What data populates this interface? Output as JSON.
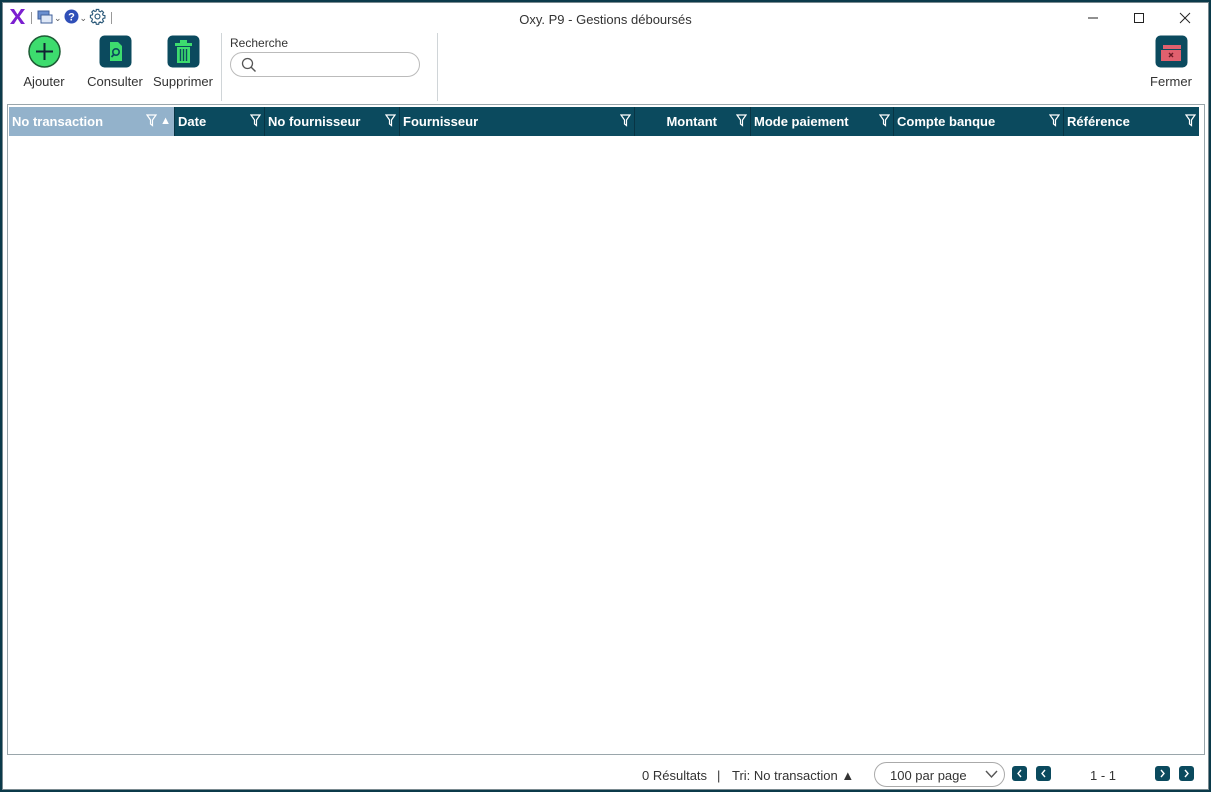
{
  "window": {
    "title": "Oxy. P9 - Gestions déboursés"
  },
  "quick_access": {
    "icons": [
      "app-logo-icon",
      "windows-icon",
      "help-icon",
      "settings-icon"
    ]
  },
  "ribbon": {
    "add_label": "Ajouter",
    "view_label": "Consulter",
    "delete_label": "Supprimer",
    "close_label": "Fermer",
    "search_label": "Recherche",
    "search_value": "",
    "search_placeholder": ""
  },
  "grid": {
    "columns": [
      {
        "label": "No transaction"
      },
      {
        "label": "Date"
      },
      {
        "label": "No fournisseur"
      },
      {
        "label": "Fournisseur"
      },
      {
        "label": "Montant"
      },
      {
        "label": "Mode paiement"
      },
      {
        "label": "Compte banque"
      },
      {
        "label": "Référence"
      }
    ],
    "rows": []
  },
  "footer": {
    "results": "0 Résultats",
    "separator": "|",
    "sort": "Tri: No transaction ▲",
    "per_page": "100 par page",
    "page_info": "1 - 1"
  },
  "colors": {
    "accent": "#0b4a5e",
    "header_sorted": "#93b2cb",
    "add_green": "#3ddc6e",
    "logo_purple": "#7b1fd0",
    "close_red": "#e0606e"
  }
}
